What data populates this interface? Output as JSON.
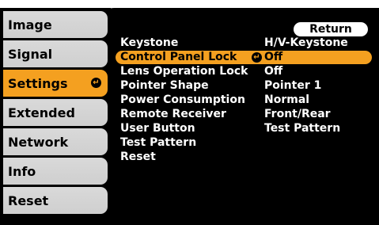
{
  "sidebar": {
    "items": [
      {
        "label": "Image"
      },
      {
        "label": "Signal"
      },
      {
        "label": "Settings"
      },
      {
        "label": "Extended"
      },
      {
        "label": "Network"
      },
      {
        "label": "Info"
      },
      {
        "label": "Reset"
      }
    ],
    "enter_glyph": "↵"
  },
  "return_label": "Return",
  "settings": {
    "rows": [
      {
        "label": "Keystone",
        "value": "H/V-Keystone"
      },
      {
        "label": "Control Panel Lock",
        "value": "Off"
      },
      {
        "label": "Lens Operation Lock",
        "value": "Off"
      },
      {
        "label": "Pointer Shape",
        "value": "Pointer 1"
      },
      {
        "label": "Power Consumption",
        "value": "Normal"
      },
      {
        "label": "Remote Receiver",
        "value": "Front/Rear"
      },
      {
        "label": "User Button",
        "value": "Test Pattern"
      },
      {
        "label": "Test Pattern",
        "value": ""
      },
      {
        "label": "Reset",
        "value": ""
      }
    ]
  },
  "colors": {
    "accent": "#f4a020",
    "sidebar_item": "#d6d6d6",
    "background": "#000000"
  }
}
